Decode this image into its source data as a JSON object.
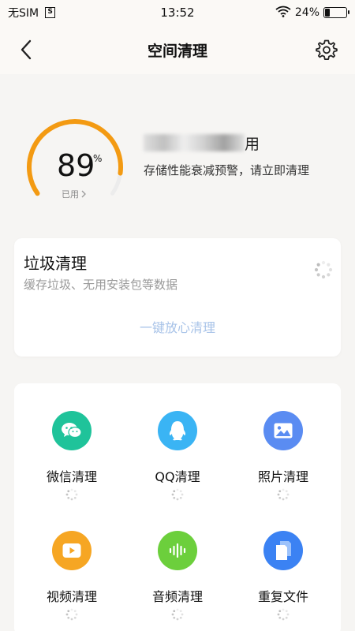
{
  "status_bar": {
    "carrier": "无SIM",
    "sim_icon_text": "S",
    "time": "13:52",
    "battery": "24%",
    "battery_level": 0.24
  },
  "header": {
    "title": "空间清理"
  },
  "storage": {
    "used_value": "89",
    "used_unit": "%",
    "used_label": "已用",
    "used_fraction": 0.89,
    "title_suffix": "用",
    "warning": "存储性能衰减预警，请立即清理"
  },
  "junk": {
    "title": "垃圾清理",
    "description": "缓存垃圾、无用安装包等数据",
    "button": "一键放心清理"
  },
  "categories": [
    {
      "label": "微信清理",
      "icon": "wechat-icon",
      "color": "#1fc39a"
    },
    {
      "label": "QQ清理",
      "icon": "qq-icon",
      "color": "#3ab4f4"
    },
    {
      "label": "照片清理",
      "icon": "photo-icon",
      "color": "#5a8cf2"
    },
    {
      "label": "视频清理",
      "icon": "video-icon",
      "color": "#f6a623"
    },
    {
      "label": "音频清理",
      "icon": "audio-icon",
      "color": "#6ccf3c"
    },
    {
      "label": "重复文件",
      "icon": "duplicate-file-icon",
      "color": "#3b82f3"
    }
  ],
  "colors": {
    "gauge_used": "#f39a12",
    "gauge_track": "#ececec",
    "accent_link": "#a8c3e8"
  }
}
